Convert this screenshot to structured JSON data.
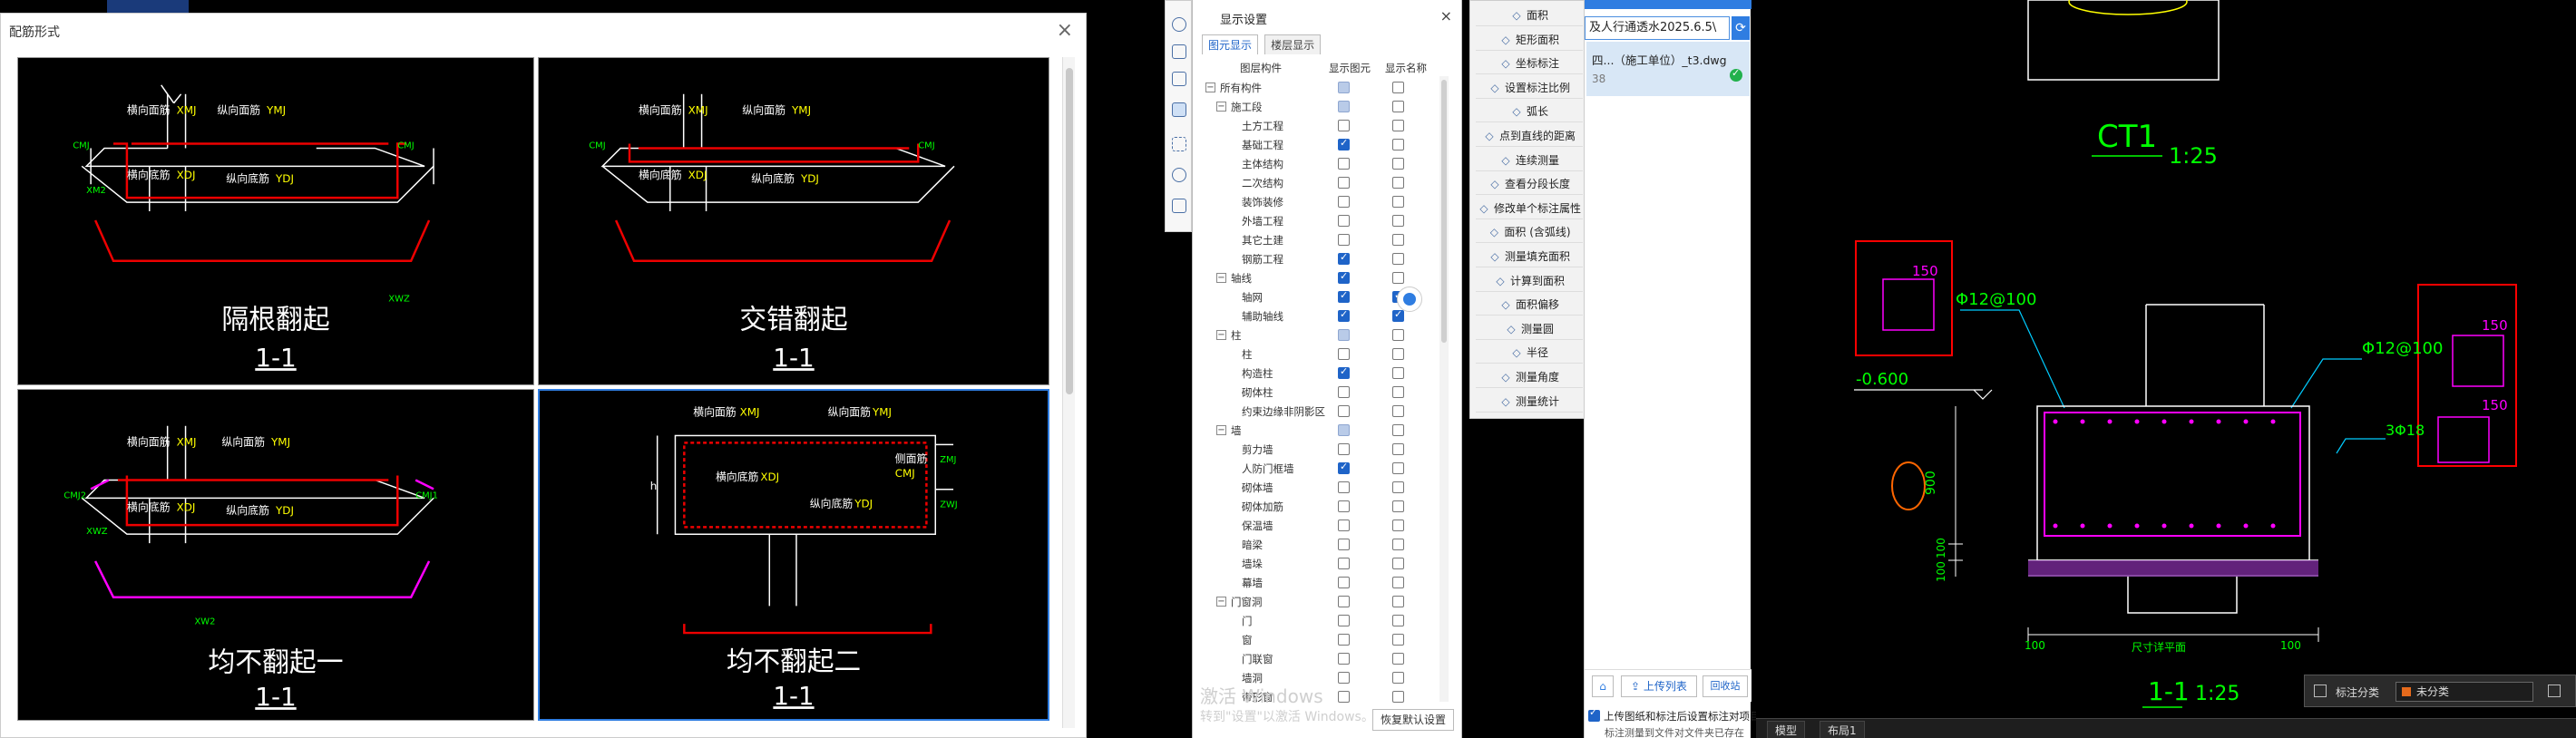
{
  "dialog": {
    "title": "配筋形式",
    "close": "×",
    "panels": [
      {
        "caption": "隔根翻起",
        "section": "1-1",
        "tags": {
          "top_cross": "横向面筋",
          "top_cross_code": "XMJ",
          "top_long": "纵向面筋",
          "top_long_code": "YMJ",
          "bot_cross": "横向底筋",
          "bot_cross_code": "XDJ",
          "bot_long": "纵向底筋",
          "bot_long_code": "YDJ",
          "side1": "XMJ",
          "side2": "CMJ",
          "side3": "XM2",
          "side4": "XWZ",
          "side5": "CMJ"
        }
      },
      {
        "caption": "交错翻起",
        "section": "1-1",
        "tags": {
          "top_cross": "横向面筋",
          "top_cross_code": "XMJ",
          "top_long": "纵向面筋",
          "top_long_code": "YMJ",
          "bot_cross": "横向底筋",
          "bot_cross_code": "XDJ",
          "bot_long": "纵向底筋",
          "bot_long_code": "YDJ",
          "side1": "CMJ",
          "side2": "CMJ"
        }
      },
      {
        "caption": "均不翻起一",
        "section": "1-1",
        "tags": {
          "top_cross": "横向面筋",
          "top_cross_code": "XMJ",
          "top_long": "纵向面筋",
          "top_long_code": "YMJ",
          "bot_cross": "横向底筋",
          "bot_cross_code": "XDJ",
          "bot_long": "纵向底筋",
          "bot_long_code": "YDJ",
          "side1": "CMJ2",
          "side2": "CMJ1",
          "side3": "XWZ",
          "side4": "XW2"
        }
      },
      {
        "caption": "均不翻起二",
        "section": "1-1",
        "tags": {
          "top_cross": "横向面筋",
          "top_cross_code": "XMJ",
          "top_long": "纵向面筋",
          "top_long_code": "YMJ",
          "bot_cross": "横向底筋",
          "bot_cross_code": "XDJ",
          "bot_long": "纵向底筋",
          "bot_long_code": "YDJ",
          "side": "侧面筋",
          "side_code": "CMJ",
          "h": "h",
          "ext": "ZMJ",
          "ext2": "ZWJ"
        }
      }
    ]
  },
  "settings": {
    "title": "显示设置",
    "close": "×",
    "tabs": [
      "图元显示",
      "楼层显示"
    ],
    "columns": [
      "图层构件",
      "显示图元",
      "显示名称"
    ],
    "rows": [
      {
        "label": "所有构件",
        "level": 0,
        "toggle": "−",
        "show": "part",
        "name": "off"
      },
      {
        "label": "施工段",
        "level": 1,
        "toggle": "−",
        "show": "part",
        "name": "off"
      },
      {
        "label": "土方工程",
        "level": 2,
        "show": "off",
        "name": "off"
      },
      {
        "label": "基础工程",
        "level": 2,
        "show": "on",
        "name": "off"
      },
      {
        "label": "主体结构",
        "level": 2,
        "show": "off",
        "name": "off"
      },
      {
        "label": "二次结构",
        "level": 2,
        "show": "off",
        "name": "off"
      },
      {
        "label": "装饰装修",
        "level": 2,
        "show": "off",
        "name": "off"
      },
      {
        "label": "外墙工程",
        "level": 2,
        "show": "off",
        "name": "off"
      },
      {
        "label": "其它土建",
        "level": 2,
        "show": "off",
        "name": "off"
      },
      {
        "label": "钢筋工程",
        "level": 2,
        "show": "on",
        "name": "off"
      },
      {
        "label": "轴线",
        "level": 1,
        "toggle": "−",
        "show": "on",
        "name": "off"
      },
      {
        "label": "轴网",
        "level": 2,
        "show": "on",
        "name": "on"
      },
      {
        "label": "辅助轴线",
        "level": 2,
        "show": "on",
        "name": "on"
      },
      {
        "label": "柱",
        "level": 1,
        "toggle": "−",
        "show": "part",
        "name": "off"
      },
      {
        "label": "柱",
        "level": 2,
        "show": "off",
        "name": "off"
      },
      {
        "label": "构造柱",
        "level": 2,
        "show": "on",
        "name": "off"
      },
      {
        "label": "砌体柱",
        "level": 2,
        "show": "off",
        "name": "off"
      },
      {
        "label": "约束边缘非阴影区",
        "level": 2,
        "show": "off",
        "name": "off"
      },
      {
        "label": "墙",
        "level": 1,
        "toggle": "−",
        "show": "part",
        "name": "off"
      },
      {
        "label": "剪力墙",
        "level": 2,
        "show": "off",
        "name": "off"
      },
      {
        "label": "人防门框墙",
        "level": 2,
        "show": "on",
        "name": "off"
      },
      {
        "label": "砌体墙",
        "level": 2,
        "show": "off",
        "name": "off"
      },
      {
        "label": "砌体加筋",
        "level": 2,
        "show": "off",
        "name": "off"
      },
      {
        "label": "保温墙",
        "level": 2,
        "show": "off",
        "name": "off"
      },
      {
        "label": "暗梁",
        "level": 2,
        "show": "off",
        "name": "off"
      },
      {
        "label": "墙垛",
        "level": 2,
        "show": "off",
        "name": "off"
      },
      {
        "label": "幕墙",
        "level": 2,
        "show": "off",
        "name": "off"
      },
      {
        "label": "门窗洞",
        "level": 1,
        "toggle": "−",
        "show": "off",
        "name": "off"
      },
      {
        "label": "门",
        "level": 2,
        "show": "off",
        "name": "off"
      },
      {
        "label": "窗",
        "level": 2,
        "show": "off",
        "name": "off"
      },
      {
        "label": "门联窗",
        "level": 2,
        "show": "off",
        "name": "off"
      },
      {
        "label": "墙洞",
        "level": 2,
        "show": "off",
        "name": "off"
      },
      {
        "label": "带形窗",
        "level": 2,
        "show": "off",
        "name": "off"
      }
    ],
    "watermark": "激活 Windows",
    "watermark2": "转到\"设置\"以激活 Windows。",
    "restore": "恢复默认设置"
  },
  "menu": {
    "items": [
      {
        "label": "面积",
        "icon": "area-icon"
      },
      {
        "label": "矩形面积",
        "icon": "rect-area-icon"
      },
      {
        "label": "坐标标注",
        "icon": "coord-icon"
      },
      {
        "label": "设置标注比例",
        "icon": "scale-icon"
      },
      {
        "label": "弧长",
        "icon": "arc-icon"
      },
      {
        "label": "点到直线的距离",
        "icon": "point-line-icon"
      },
      {
        "label": "连续测量",
        "icon": "continuous-icon"
      },
      {
        "label": "查看分段长度",
        "icon": "segment-icon"
      },
      {
        "label": "修改单个标注属性",
        "icon": "edit-icon"
      },
      {
        "label": "面积 (含弧线)",
        "icon": "arc-area-icon"
      },
      {
        "label": "测量填充面积",
        "icon": "fill-area-icon"
      },
      {
        "label": "计算到面积",
        "icon": "calc-area-icon"
      },
      {
        "label": "面积偏移",
        "icon": "offset-icon"
      },
      {
        "label": "测量圆",
        "icon": "circle-icon"
      },
      {
        "label": "半径",
        "icon": "radius-icon"
      },
      {
        "label": "测量角度",
        "icon": "angle-icon"
      },
      {
        "label": "测量统计",
        "icon": "stats-icon"
      }
    ]
  },
  "files": {
    "top_input": "及人行通透水2025.6.5\\",
    "item_name": "四...（施工单位）_t3.dwg",
    "item_sub": "38",
    "upload": "上传列表",
    "recycle": "回收站",
    "check_label": "上传图纸和标注后设置标注对项目成员共享",
    "hint": "标注测量到文件对文件夹已存在"
  },
  "cad": {
    "title_top": "CT1",
    "scale_top": "1:25",
    "bar1": "Φ12@100",
    "bar2": "Φ12@100",
    "bar3": "3Φ18",
    "dim150a": "150",
    "dim150b": "150",
    "dim150c": "150",
    "elev": "-0.600",
    "d900": "900",
    "d100a": "100",
    "d100b": "100",
    "d100l": "100",
    "d100r": "100",
    "dimtxt": "尺寸详平面",
    "section": "1-1",
    "section_scale": "1:25"
  },
  "statusbar": {
    "tabs": [
      "模型",
      "布局1"
    ],
    "cat_label": "标注分类",
    "cat_value": "未分类"
  }
}
